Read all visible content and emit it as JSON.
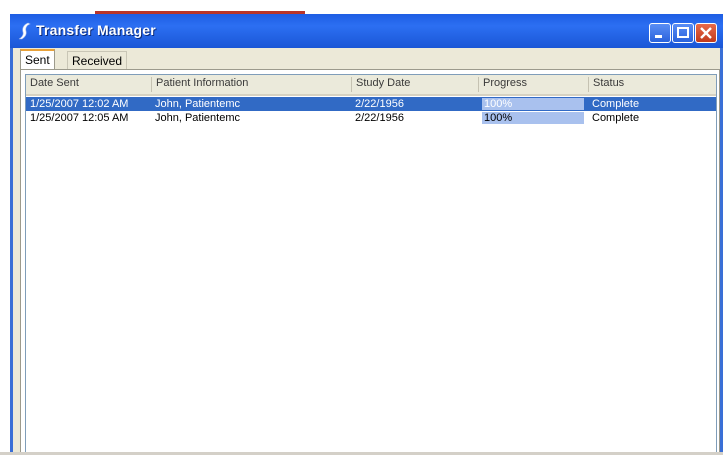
{
  "window": {
    "title": "Transfer Manager",
    "controls": [
      "minimize",
      "maximize",
      "close"
    ],
    "colors": {
      "titlebar": "#2c6ff2",
      "selection": "#316ac5",
      "progress": "#a9c1ee",
      "close": "#c13a1c"
    }
  },
  "tabs": [
    {
      "label": "Sent",
      "selected": true
    },
    {
      "label": "Received",
      "selected": false
    }
  ],
  "columns": [
    "Date Sent",
    "Patient Information",
    "Study Date",
    "Progress",
    "Status"
  ],
  "rows": [
    {
      "date_sent": "1/25/2007 12:02 AM",
      "patient": "John, Patientemc",
      "study_date": "2/22/1956",
      "progress_label": "100%",
      "progress": 1.0,
      "status": "Complete",
      "selected": true
    },
    {
      "date_sent": "1/25/2007 12:05 AM",
      "patient": "John, Patientemc",
      "study_date": "2/22/1956",
      "progress_label": "100%",
      "progress": 1.0,
      "status": "Complete",
      "selected": false
    }
  ]
}
